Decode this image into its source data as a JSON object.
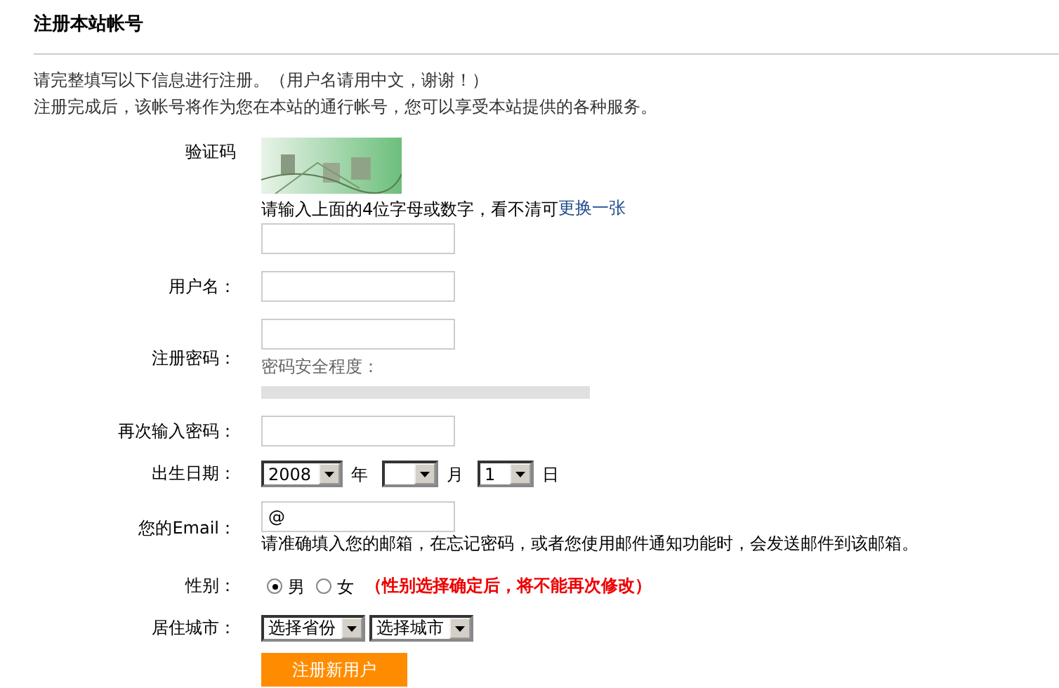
{
  "title": "注册本站帐号",
  "intro": [
    "请完整填写以下信息进行注册。（用户名请用中文，谢谢！）",
    "注册完成后，该帐号将作为您在本站的通行帐号，您可以享受本站提供的各种服务。"
  ],
  "captcha": {
    "label": "验证码",
    "hint": "请输入上面的4位字母或数字，看不清可",
    "link": "更换一张"
  },
  "username": {
    "label": "用户名："
  },
  "password": {
    "label": "注册密码：",
    "strength_label": "密码安全程度：",
    "level": 0
  },
  "confirm": {
    "label": "再次输入密码："
  },
  "birth": {
    "label": "出生日期：",
    "parts": [
      {
        "value": "2008",
        "unit": "年",
        "kind": "wide"
      },
      {
        "unit": "月",
        "kind": "narrow"
      },
      {
        "value": "1",
        "unit": "日",
        "kind": "narrow"
      }
    ]
  },
  "email": {
    "label": "您的Email：",
    "value": "@",
    "hint": "请准确填入您的邮箱，在忘记密码，或者您使用邮件通知功能时，会发送邮件到该邮箱。"
  },
  "gender": {
    "label": "性别：",
    "options": [
      {
        "label": "男",
        "selected": true
      },
      {
        "label": "女",
        "selected": false
      }
    ],
    "warning": "（性别选择确定后，将不能再次修改）"
  },
  "city": {
    "label": "居住城市：",
    "selects": [
      "选择省份",
      "选择城市"
    ]
  },
  "submit": "注册新用户"
}
